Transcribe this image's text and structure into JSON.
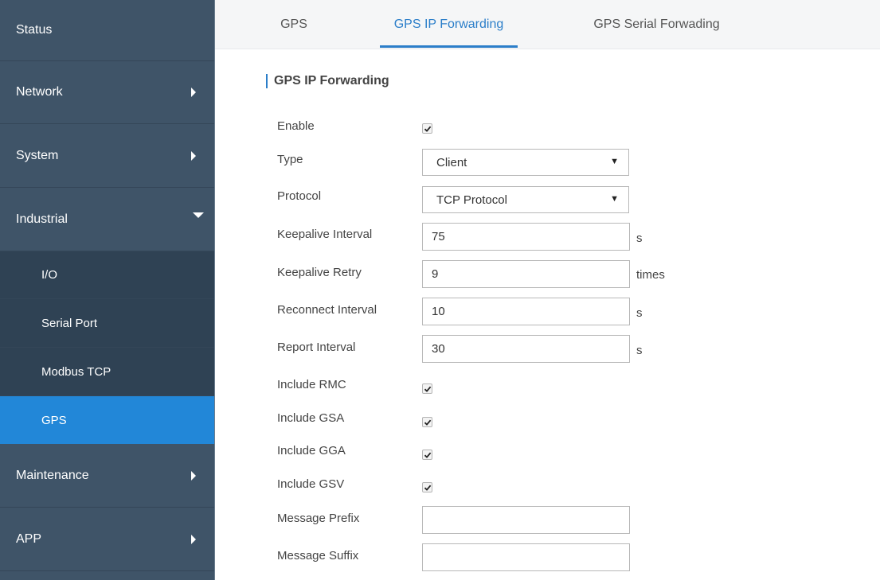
{
  "sidebar": {
    "items": [
      {
        "label": "Status"
      },
      {
        "label": "Network"
      },
      {
        "label": "System"
      },
      {
        "label": "Industrial"
      },
      {
        "label": "I/O"
      },
      {
        "label": "Serial Port"
      },
      {
        "label": "Modbus TCP"
      },
      {
        "label": "GPS"
      },
      {
        "label": "Maintenance"
      },
      {
        "label": "APP"
      }
    ]
  },
  "tabs": [
    {
      "label": "GPS"
    },
    {
      "label": "GPS IP Forwarding"
    },
    {
      "label": "GPS Serial Forwading"
    }
  ],
  "section": {
    "title": "GPS IP Forwarding"
  },
  "form": {
    "enable": {
      "label": "Enable",
      "checked": true
    },
    "type": {
      "label": "Type",
      "value": "Client"
    },
    "protocol": {
      "label": "Protocol",
      "value": "TCP Protocol"
    },
    "keepalive_interval": {
      "label": "Keepalive Interval",
      "value": "75",
      "unit": "s"
    },
    "keepalive_retry": {
      "label": "Keepalive Retry",
      "value": "9",
      "unit": "times"
    },
    "reconnect_interval": {
      "label": "Reconnect Interval",
      "value": "10",
      "unit": "s"
    },
    "report_interval": {
      "label": "Report Interval",
      "value": "30",
      "unit": "s"
    },
    "include_rmc": {
      "label": "Include RMC",
      "checked": true
    },
    "include_gsa": {
      "label": "Include GSA",
      "checked": true
    },
    "include_gga": {
      "label": "Include GGA",
      "checked": true
    },
    "include_gsv": {
      "label": "Include GSV",
      "checked": true
    },
    "message_prefix": {
      "label": "Message Prefix",
      "value": ""
    },
    "message_suffix": {
      "label": "Message Suffix",
      "value": ""
    }
  },
  "colors": {
    "sidebar_bg": "#3f5468",
    "sidebar_sub_bg": "#2f4254",
    "sidebar_active": "#2287d8",
    "accent": "#2b7ec9"
  },
  "icons": {
    "collapsed": "chevron-right-icon",
    "expanded": "chevron-down-icon",
    "checkbox": "checkmark-icon",
    "select": "caret-down-icon"
  }
}
